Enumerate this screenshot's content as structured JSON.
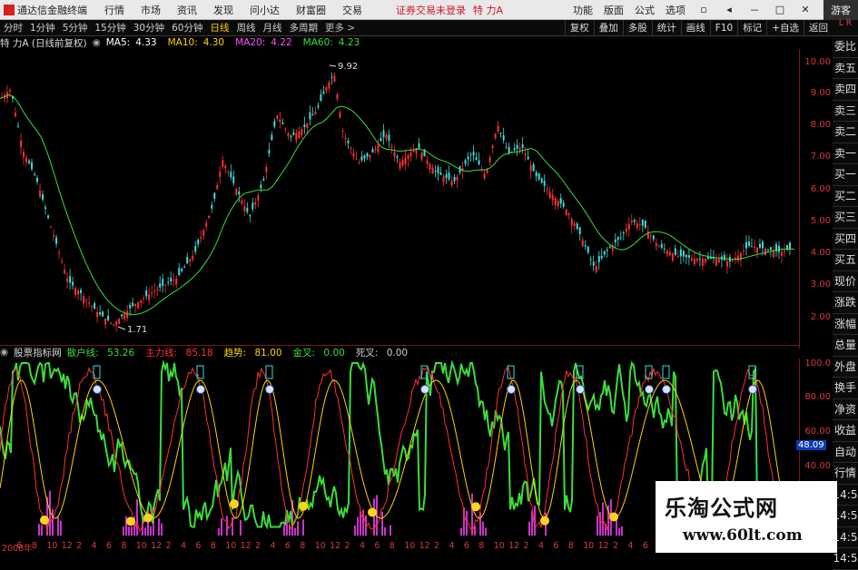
{
  "app": {
    "name": "通达信金融终端",
    "menus": [
      "行情",
      "市场",
      "资讯",
      "发现",
      "问小达",
      "财富圈",
      "交易"
    ],
    "status_text": "证券交易未登录",
    "stock_title": "特 力A",
    "right_menus": [
      "功能",
      "版面",
      "公式",
      "选项"
    ],
    "guest_label": "游客",
    "window_buttons": [
      "▫",
      "◂",
      "－",
      "□",
      "✕"
    ]
  },
  "period_bar": {
    "items": [
      "分时",
      "1分钟",
      "5分钟",
      "15分钟",
      "30分钟",
      "60分钟",
      "日线",
      "周线",
      "月线",
      "多周期",
      "更多 >"
    ],
    "active": "日线",
    "right_buttons": [
      "复权",
      "叠加",
      "多股",
      "统计",
      "画线",
      "F10",
      "标记",
      "+自选",
      "返回"
    ]
  },
  "lr_label": "L R",
  "main_info": {
    "title": "特 力A (日线前复权)",
    "ma": [
      {
        "label": "MA5:",
        "value": "4.33",
        "color": "#ffffff"
      },
      {
        "label": "MA10:",
        "value": "4.30",
        "color": "#ffd200"
      },
      {
        "label": "MA20:",
        "value": "4.22",
        "color": "#ff4dff"
      },
      {
        "label": "MA60:",
        "value": "4.23",
        "color": "#3cdc3c"
      }
    ]
  },
  "main_axis": {
    "ticks": [
      "10.00",
      "9.00",
      "8.00",
      "7.00",
      "6.00",
      "5.00",
      "4.00",
      "3.00",
      "2.00"
    ],
    "high_label": "9.92",
    "low_label": "1.71"
  },
  "side_tabs": [
    "委比",
    "卖五",
    "卖四",
    "卖三",
    "卖二",
    "卖一",
    "买一",
    "买二",
    "买三",
    "买四",
    "买五",
    "现价",
    "涨跌",
    "涨幅",
    "总量",
    "外盘",
    "换手",
    "净资",
    "收益",
    "自动",
    "行情",
    "14:5",
    "14:5",
    "14:5",
    "14:5",
    "14:5"
  ],
  "indicator": {
    "name": "股票指标网",
    "items": [
      {
        "label": "散户线:",
        "value": "53.26",
        "color": "#3cdc3c"
      },
      {
        "label": "主力线:",
        "value": "85.18",
        "color": "#ff3030"
      },
      {
        "label": "趋势:",
        "value": "81.00",
        "color": "#ffd200"
      },
      {
        "label": "金叉:",
        "value": "0.00",
        "color": "#3cdc3c"
      },
      {
        "label": "死叉:",
        "value": "0.00",
        "color": "#cfcfcf"
      }
    ],
    "ticks": [
      "100.0",
      "80.00",
      "60.00",
      "40.00"
    ],
    "current_value": "48.09"
  },
  "x_axis": [
    "2008年",
    "6",
    "8",
    "10",
    "12",
    "2",
    "4",
    "6",
    "8",
    "10",
    "12",
    "2",
    "4",
    "6",
    "8",
    "10",
    "12",
    "2",
    "4",
    "6",
    "8",
    "10",
    "12",
    "2",
    "4",
    "6",
    "8",
    "10",
    "12",
    "2",
    "4",
    "6",
    "8",
    "10",
    "12",
    "2",
    "4",
    "6",
    "8",
    "10",
    "12",
    "2",
    "4",
    "6",
    "8",
    "10",
    "12",
    "2",
    "4",
    "6",
    "8",
    "10",
    "12"
  ],
  "watermark": {
    "title": "乐淘公式网",
    "url": "www.60lt.com"
  },
  "colors": {
    "up": "#ff3030",
    "down": "#3cdcdc",
    "ma60": "#3cdc3c",
    "retail": "#3cdc3c",
    "main": "#ff3030",
    "trend": "#ffd200",
    "bars": "#cc33cc"
  }
}
